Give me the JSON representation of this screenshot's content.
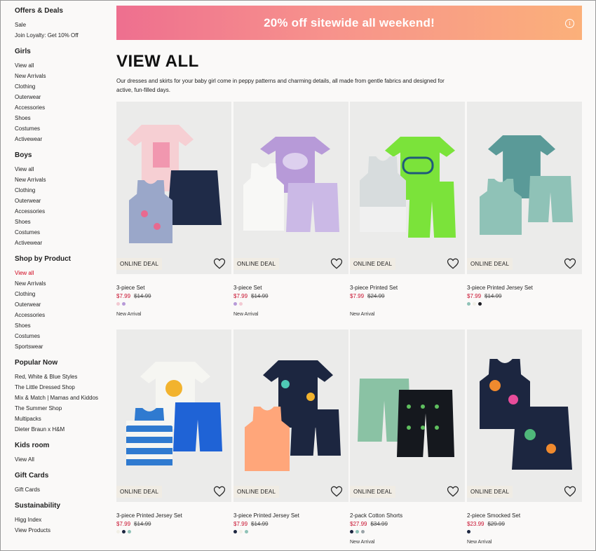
{
  "sidebar": {
    "sections": [
      {
        "heading": "Offers & Deals",
        "items": [
          "Sale",
          "Join Loyalty: Get 10% Off"
        ]
      },
      {
        "heading": "Girls",
        "items": [
          "View all",
          "New Arrivals",
          "Clothing",
          "Outerwear",
          "Accessories",
          "Shoes",
          "Costumes",
          "Activewear"
        ]
      },
      {
        "heading": "Boys",
        "items": [
          "View all",
          "New Arrivals",
          "Clothing",
          "Outerwear",
          "Accessories",
          "Shoes",
          "Costumes",
          "Activewear"
        ]
      },
      {
        "heading": "Shop by Product",
        "items": [
          "View all",
          "New Arrivals",
          "Clothing",
          "Outerwear",
          "Accessories",
          "Shoes",
          "Costumes",
          "Sportswear"
        ]
      },
      {
        "heading": "Popular Now",
        "items": [
          "Red, White & Blue Styles",
          "The Little Dressed Shop",
          "Mix & Match | Mamas and Kiddos",
          "The Summer Shop",
          "Multipacks",
          "Dieter Braun x H&M"
        ]
      },
      {
        "heading": "Kids room",
        "items": [
          "View All"
        ]
      },
      {
        "heading": "Gift Cards",
        "items": [
          "Gift Cards"
        ]
      },
      {
        "heading": "Sustainability",
        "items": [
          "Higg Index",
          "View Products"
        ]
      }
    ],
    "active": "Shop by Product / View all",
    "active_color": "#d0021b"
  },
  "banner": {
    "text": "20% off sitewide all weekend!",
    "info_icon": "i"
  },
  "page": {
    "title": "VIEW ALL",
    "description": "Our dresses and skirts for your baby girl come in peppy patterns and charming details, all made from gentle fabrics and designed for active, fun-filled days."
  },
  "deal_label": "ONLINE DEAL",
  "products": [
    {
      "name": "3-piece Set",
      "price": "$7.99",
      "old_price": "$14.99",
      "swatches": [
        "#f2c9d2",
        "#b79ad8"
      ],
      "badge": "New Arrival"
    },
    {
      "name": "3-piece Set",
      "price": "$7.99",
      "old_price": "$14.99",
      "swatches": [
        "#b79ad8",
        "#f2c9d2"
      ],
      "badge": "New Arrival"
    },
    {
      "name": "3-piece Printed Set",
      "price": "$7.99",
      "old_price": "$24.99",
      "swatches": [],
      "badge": "New Arrival"
    },
    {
      "name": "3-piece Printed Jersey Set",
      "price": "$7.99",
      "old_price": "$14.99",
      "swatches": [
        "#8fc2b7",
        "#f1efe6",
        "#1c1c22"
      ],
      "badge": ""
    },
    {
      "name": "3-piece Printed Jersey Set",
      "price": "$7.99",
      "old_price": "$14.99",
      "swatches": [
        "#f1efe6",
        "#1c2640",
        "#8fc2b7"
      ],
      "badge": ""
    },
    {
      "name": "3-piece Printed Jersey Set",
      "price": "$7.99",
      "old_price": "$14.99",
      "swatches": [
        "#1c2640",
        "#f1efe6",
        "#8fc2b7"
      ],
      "badge": ""
    },
    {
      "name": "2-pack Cotton Shorts",
      "price": "$27.99",
      "old_price": "$34.99",
      "swatches": [
        "#1c2640",
        "#8fc2b7",
        "#9aa3a8"
      ],
      "badge": "New Arrival"
    },
    {
      "name": "2-piece Smocked Set",
      "price": "$23.99",
      "old_price": "$29.99",
      "swatches": [
        "#1c2640"
      ],
      "badge": "New Arrival"
    }
  ]
}
